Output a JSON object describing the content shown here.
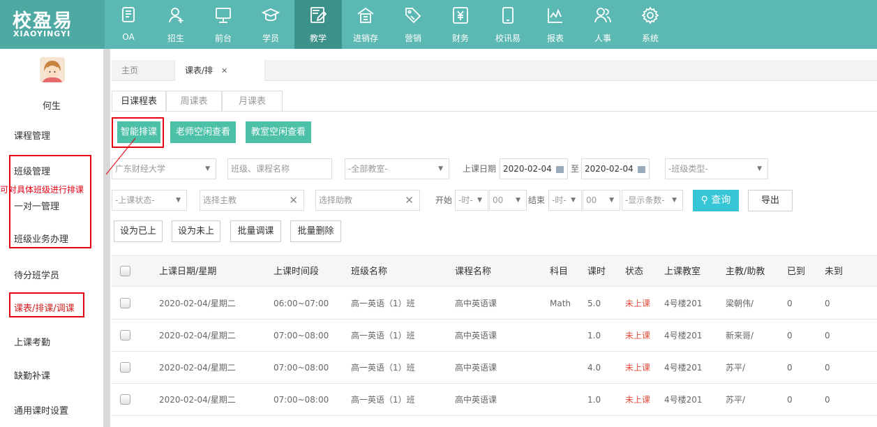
{
  "logo": {
    "title": "校盈易",
    "subtitle": "XIAOYINGYI"
  },
  "nav": [
    {
      "label": "OA",
      "icon": "book-icon"
    },
    {
      "label": "招生",
      "icon": "user-plus-icon"
    },
    {
      "label": "前台",
      "icon": "monitor-icon"
    },
    {
      "label": "学员",
      "icon": "graduation-cap-icon"
    },
    {
      "label": "教学",
      "icon": "edit-icon",
      "active": true
    },
    {
      "label": "进销存",
      "icon": "warehouse-icon"
    },
    {
      "label": "营销",
      "icon": "tag-icon"
    },
    {
      "label": "财务",
      "icon": "yen-icon"
    },
    {
      "label": "校讯易",
      "icon": "phone-icon"
    },
    {
      "label": "报表",
      "icon": "chart-icon"
    },
    {
      "label": "人事",
      "icon": "people-icon"
    },
    {
      "label": "系统",
      "icon": "gear-icon"
    }
  ],
  "sidebar": {
    "user_name": "何生",
    "annotation": "可对具体班级进行排课",
    "items": [
      "课程管理",
      "班级管理",
      "一对一管理",
      "班级业务办理",
      "待分班学员",
      "课表/排课/调课",
      "上课考勤",
      "缺勤补课",
      "通用课时设置"
    ]
  },
  "page_tabs": {
    "home": "主页",
    "current": "课表/排",
    "close": "✕"
  },
  "sub_tabs": [
    "日课程表",
    "周课表",
    "月课表"
  ],
  "actions": [
    "智能排课",
    "老师空闲查看",
    "教室空闲查看"
  ],
  "filters": {
    "school": "广东财经大学",
    "class_course_placeholder": "班级、课程名称",
    "classroom": "-全部教室-",
    "date_label": "上课日期",
    "date_from": "2020-02-04",
    "date_to_label": "至",
    "date_to": "2020-02-04",
    "class_type": "-班级类型-",
    "status": "-上课状态-",
    "teacher_placeholder": "选择主教",
    "assistant_placeholder": "选择助教",
    "start_label": "开始",
    "start_hour": "-时-",
    "start_min": "00",
    "end_label": "结束",
    "end_hour": "-时-",
    "end_min": "00",
    "show_count": "-显示条数-",
    "query": "查询",
    "export": "导出"
  },
  "batch_actions": [
    "设为已上",
    "设为未上",
    "批量调课",
    "批量删除"
  ],
  "table": {
    "headers": [
      "上课日期/星期",
      "上课时间段",
      "班级名称",
      "课程名称",
      "科目",
      "课时",
      "状态",
      "上课教室",
      "主教/助教",
      "已到",
      "未到"
    ],
    "rows": [
      [
        "2020-02-04/星期二",
        "06:00~07:00",
        "高一英语（1）班",
        "高中英语课",
        "Math",
        "5.0",
        "未上课",
        "4号楼201",
        "梁朝伟/",
        "0",
        "0"
      ],
      [
        "2020-02-04/星期二",
        "07:00~08:00",
        "高一英语（1）班",
        "高中英语课",
        "",
        "1.0",
        "未上课",
        "4号楼201",
        "新来哥/",
        "0",
        "0"
      ],
      [
        "2020-02-04/星期二",
        "07:00~08:00",
        "高一英语（1）班",
        "高中英语课",
        "",
        "4.0",
        "未上课",
        "4号楼201",
        "苏平/",
        "0",
        "0"
      ],
      [
        "2020-02-04/星期二",
        "07:00~08:00",
        "高一英语（1）班",
        "高中英语课",
        "",
        "1.0",
        "未上课",
        "4号楼201",
        "苏平/",
        "0",
        "0"
      ]
    ]
  },
  "colors": {
    "topbar": "#5cb8b2",
    "accent_green": "#4dc0a8",
    "query": "#37c6d6",
    "annotation_red": "#e60012",
    "status_red": "#e74c3c"
  }
}
